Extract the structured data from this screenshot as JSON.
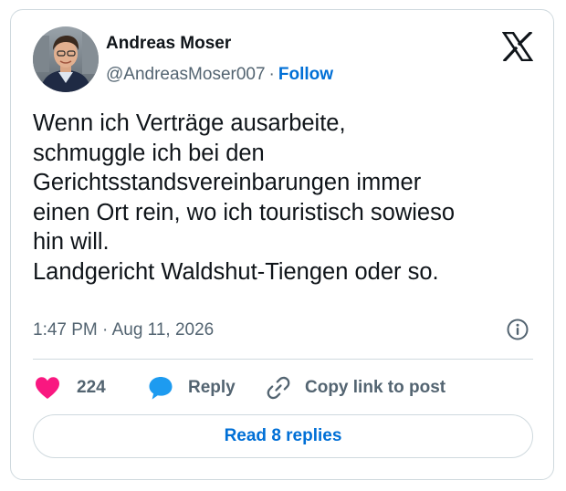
{
  "author": {
    "name": "Andreas Moser",
    "handle": "@AndreasMoser007",
    "separator": "·",
    "follow_label": "Follow"
  },
  "tweet": {
    "lines": [
      "Wenn ich Verträge ausarbeite,",
      "schmuggle ich bei den",
      "Gerichtsstandsvereinbarungen immer",
      "einen Ort rein, wo ich touristisch sowieso",
      "hin will.",
      "Landgericht Waldshut-Tiengen oder so."
    ],
    "timestamp": "1:47 PM · Aug 11, 2026"
  },
  "actions": {
    "like_count": "224",
    "reply_label": "Reply",
    "copy_label": "Copy link to post"
  },
  "read_replies_label": "Read 8 replies",
  "icons": {
    "brand": "x-logo-icon",
    "info": "info-icon",
    "like": "heart-icon",
    "reply": "speech-bubble-icon",
    "copy": "link-icon"
  },
  "colors": {
    "text": "#0f1419",
    "secondary": "#536471",
    "link": "#006fd6",
    "like": "#f91880",
    "reply": "#1d9bf0",
    "border": "#cfd9de"
  }
}
